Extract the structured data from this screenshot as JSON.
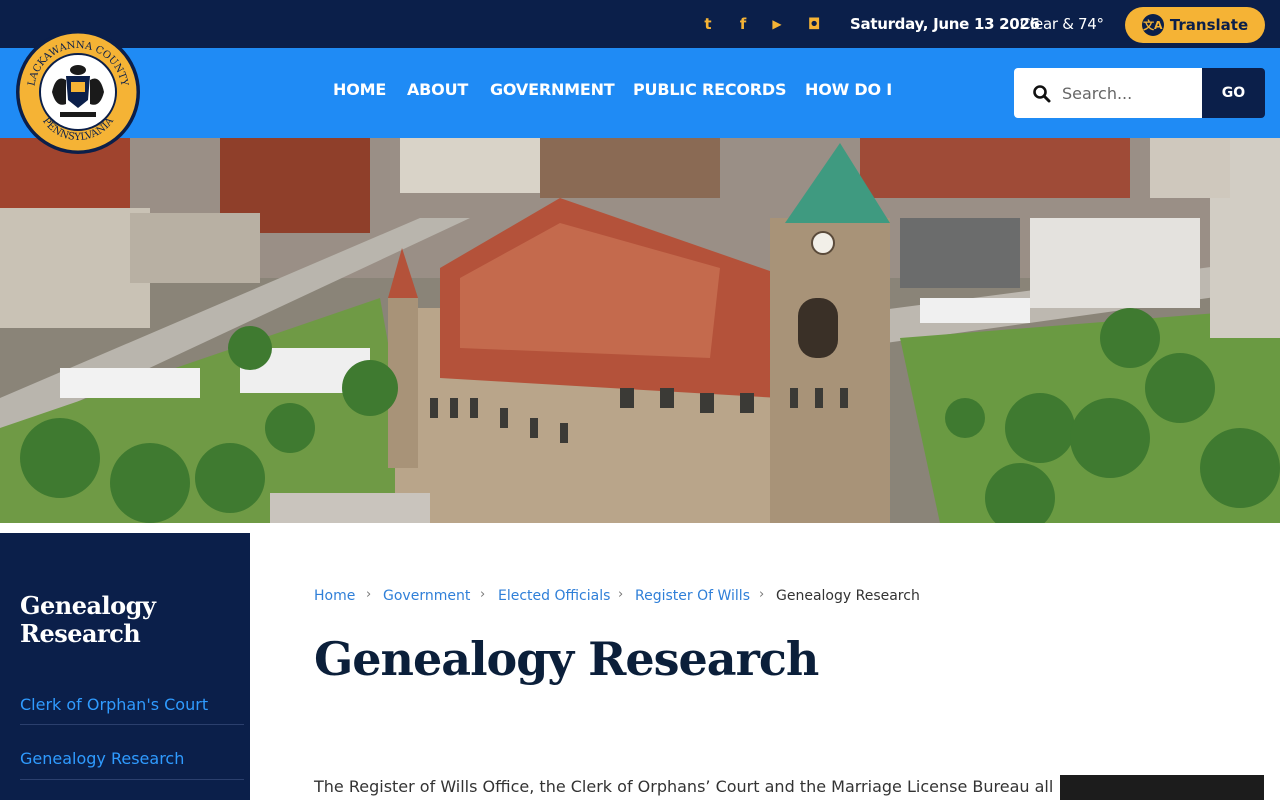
{
  "topbar": {
    "social": [
      {
        "name": "twitter",
        "glyph": "t"
      },
      {
        "name": "facebook",
        "glyph": "f"
      },
      {
        "name": "youtube",
        "glyph": "▶"
      },
      {
        "name": "instagram",
        "glyph": "◘"
      }
    ],
    "date": "Saturday, June 13 2026",
    "weather": "Clear & 74°",
    "translate_label": "Translate",
    "translate_icon_glyph": "文A"
  },
  "logo": {
    "text_top": "LACKAWANNA COUNTY",
    "text_bottom": "PENNSYLVANIA"
  },
  "nav": {
    "items": [
      "HOME",
      "ABOUT",
      "GOVERNMENT",
      "PUBLIC RECORDS",
      "HOW DO I"
    ]
  },
  "search": {
    "placeholder": "Search...",
    "button_label": "GO"
  },
  "sidebar": {
    "title": "Genealogy Research",
    "links": [
      "Clerk of Orphan's Court",
      "Genealogy Research"
    ]
  },
  "breadcrumb": {
    "items": [
      "Home",
      "Government",
      "Elected Officials",
      "Register Of Wills"
    ],
    "current": "Genealogy Research",
    "separator": "›"
  },
  "main": {
    "title": "Genealogy Research",
    "intro": "The Register of Wills Office, the Clerk of Orphans’ Court and the Marriage License Bureau all"
  },
  "colors": {
    "navy": "#0b1f4a",
    "blue": "#1f8bf5",
    "gold": "#f5b335",
    "link": "#2f7fd8"
  }
}
